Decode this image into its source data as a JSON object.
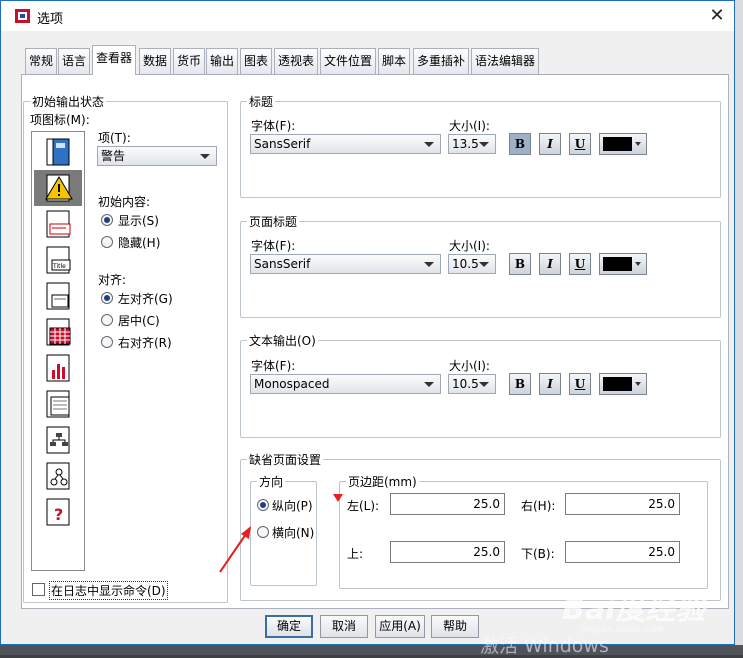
{
  "window": {
    "title": "选项",
    "close_label": "✕"
  },
  "tabs": [
    {
      "label": "常规",
      "active": false
    },
    {
      "label": "语言",
      "active": false
    },
    {
      "label": "查看器",
      "active": true
    },
    {
      "label": "数据",
      "active": false
    },
    {
      "label": "货币",
      "active": false
    },
    {
      "label": "输出",
      "active": false
    },
    {
      "label": "图表",
      "active": false
    },
    {
      "label": "透视表",
      "active": false
    },
    {
      "label": "文件位置",
      "active": false
    },
    {
      "label": "脚本",
      "active": false
    },
    {
      "label": "多重插补",
      "active": false
    },
    {
      "label": "语法编辑器",
      "active": false
    }
  ],
  "initial_output": {
    "legend": "初始输出状态",
    "icon_label": "项图标(M):",
    "item_label": "项(T):",
    "item_value": "警告",
    "icons": [
      "log-book-icon",
      "warning-icon",
      "notes-icon",
      "title-icon",
      "page-title-icon",
      "pivot-table-icon",
      "chart-icon",
      "text-output-icon",
      "tree-model-icon",
      "model-icon",
      "unknown-object-icon"
    ],
    "initial_content_label": "初始内容:",
    "show_label": "显示(S)",
    "hide_label": "隐藏(H)",
    "align_label": "对齐:",
    "align_left_label": "左对齐(G)",
    "align_center_label": "居中(C)",
    "align_right_label": "右对齐(R)",
    "show_commands_label": "在日志中显示命令(D)"
  },
  "title_group": {
    "legend": "标题",
    "font_label": "字体(F):",
    "size_label": "大小(I):",
    "font": "SansSerif",
    "size": "13.5",
    "bold": true,
    "italic": false,
    "underline": false,
    "color": "#000000"
  },
  "page_title_group": {
    "legend": "页面标题",
    "font_label": "字体(F):",
    "size_label": "大小(I):",
    "font": "SansSerif",
    "size": "10.5",
    "bold": false,
    "italic": false,
    "underline": false,
    "color": "#000000"
  },
  "text_output_group": {
    "legend": "文本输出(O)",
    "font_label": "字体(F):",
    "size_label": "大小(I):",
    "font": "Monospaced",
    "size": "10.5",
    "bold": false,
    "italic": false,
    "underline": false,
    "color": "#000000"
  },
  "page_setup": {
    "legend": "缺省页面设置",
    "orientation_legend": "方向",
    "portrait_label": "纵向(P)",
    "landscape_label": "横向(N)",
    "orientation": "portrait",
    "margins_legend": "页边距(mm)",
    "left_label": "左(L):",
    "left_value": "25.0",
    "right_label": "右(H):",
    "right_value": "25.0",
    "top_label": "上:",
    "top_value": "25.0",
    "bottom_label": "下(B):",
    "bottom_value": "25.0"
  },
  "buttons": {
    "ok": "确定",
    "cancel": "取消",
    "apply": "应用(A)",
    "help": "帮助"
  },
  "format_buttons": {
    "bold": "B",
    "italic": "I",
    "underline": "U"
  },
  "overlay": {
    "activate_text": "激活 Windows",
    "logo": "Bai度经验",
    "url": "jingyan.baidu.com"
  }
}
